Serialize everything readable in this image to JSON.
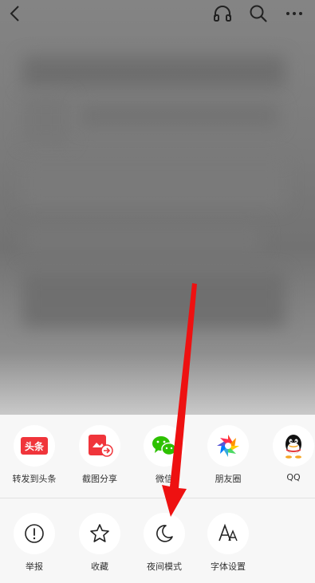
{
  "colors": {
    "accent_red": "#f0353b",
    "wechat_green": "#2dc100",
    "annotation_arrow": "#ee1111",
    "sheet_bg": "#f7f7f7"
  },
  "topbar": {
    "back_icon": "chevron-left-icon",
    "listen_icon": "headphones-icon",
    "search_icon": "search-icon",
    "more_icon": "more-dots-icon"
  },
  "share_row": [
    {
      "label": "转发到头条",
      "icon": "toutiao-logo-icon",
      "logo_text": "头条"
    },
    {
      "label": "截图分享",
      "icon": "screenshot-share-icon"
    },
    {
      "label": "微信",
      "icon": "wechat-icon"
    },
    {
      "label": "朋友圈",
      "icon": "moments-icon"
    },
    {
      "label": "QQ",
      "icon": "qq-icon"
    }
  ],
  "tool_row": [
    {
      "label": "举报",
      "icon": "exclamation-icon"
    },
    {
      "label": "收藏",
      "icon": "star-icon"
    },
    {
      "label": "夜间模式",
      "icon": "moon-icon"
    },
    {
      "label": "字体设置",
      "icon": "font-size-icon"
    }
  ]
}
